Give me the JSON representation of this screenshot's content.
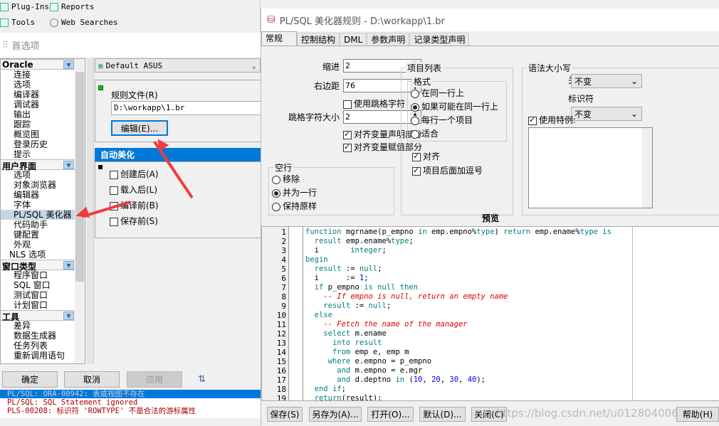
{
  "toolbar": {
    "items": [
      {
        "label": "Plug-Ins",
        "icon": "plugin-icon"
      },
      {
        "label": "Reports",
        "icon": "report-icon"
      },
      {
        "label": "Tools",
        "icon": "tools-icon"
      },
      {
        "label": "Web Searches",
        "icon": "globe-icon"
      }
    ]
  },
  "preferences": {
    "title": "首选项",
    "sidebar": {
      "groups": [
        {
          "label": "Oracle",
          "items": [
            "连接",
            "选项",
            "编译器",
            "调试器",
            "输出",
            "跟踪",
            "概览图",
            "登录历史",
            "提示"
          ]
        },
        {
          "label": "用户界面",
          "items": [
            "选项",
            "对象浏览器",
            "编辑器",
            "字体",
            "PL/SQL 美化器",
            "代码助手",
            "键配置",
            "外观",
            "NLS 选项"
          ]
        },
        {
          "label": "窗口类型",
          "items": [
            "程序窗口",
            "SQL 窗口",
            "测试窗口",
            "计划窗口"
          ]
        },
        {
          "label": "工具",
          "items": [
            "差异",
            "数据生成器",
            "任务列表",
            "重新调用语句"
          ]
        }
      ],
      "selected": "PL/SQL 美化器"
    },
    "profile": "Default ASUS",
    "rules_file_label": "规则文件(R)",
    "rules_file_value": "D:\\workapp\\1.br",
    "edit_button": "编辑(E)...",
    "auto_header": "自动美化",
    "auto_options": [
      {
        "label": "创建后(A)",
        "checked": false
      },
      {
        "label": "载入后(L)",
        "checked": false
      },
      {
        "label": "编译前(B)",
        "checked": false
      },
      {
        "label": "保存前(S)",
        "checked": false
      }
    ],
    "buttons": {
      "ok": "确定",
      "cancel": "取消",
      "apply": "应用"
    },
    "errors": [
      "PL/SQL: ORA-00942: 表或视图不存在",
      "PL/SQL: SQL Statement ignored",
      "PLS-00208: 标识符 'ROWTYPE' 不是合法的游标属性"
    ]
  },
  "dialog": {
    "title": "PL/SQL 美化器规则 - D:\\workapp\\1.br",
    "tabs": [
      "常规",
      "控制结构",
      "DML",
      "参数声明",
      "记录类型声明"
    ],
    "active_tab": "常规",
    "indent_label": "缩进",
    "indent_value": "2",
    "right_margin_label": "右边距",
    "right_margin_value": "76",
    "use_tab_label": "使用跳格字符",
    "use_tab": false,
    "tab_size_label": "跳格字符大小",
    "tab_size_value": "2",
    "align_decl_label": "对齐变量声明部分",
    "align_decl": true,
    "align_assign_label": "对齐变量赋值部分",
    "align_assign": true,
    "blank_lines": {
      "label": "空行",
      "options": [
        "移除",
        "并为一行",
        "保持原样"
      ],
      "selected": "并为一行"
    },
    "item_list": {
      "label": "项目列表",
      "format_label": "格式",
      "options": [
        "在同一行上",
        "如果可能在同一行上",
        "每行一个项目",
        "适合"
      ],
      "selected": "如果可能在同一行上",
      "align_label": "对齐",
      "align": true,
      "comma_label": "项目后面加逗号",
      "comma": true
    },
    "case": {
      "label": "语法大小写",
      "keyword_label": "关键字",
      "keyword_value": "不变",
      "identifier_label": "标识符",
      "identifier_value": "不变",
      "use_special_label": "使用特例:",
      "use_special": true
    },
    "preview_label": "预览",
    "code": [
      [
        [
          "k",
          "function "
        ],
        [
          "t",
          "mgrname(p_empno "
        ],
        [
          "k",
          "in "
        ],
        [
          "t",
          "emp.empno%"
        ],
        [
          "k",
          "type"
        ],
        [
          "t",
          ") "
        ],
        [
          "k",
          "return "
        ],
        [
          "t",
          "emp.ename%"
        ],
        [
          "k",
          "type is"
        ]
      ],
      [
        [
          "t",
          "  "
        ],
        [
          "k",
          "result "
        ],
        [
          "t",
          "emp.ename%"
        ],
        [
          "k",
          "type"
        ],
        [
          "t",
          ";"
        ]
      ],
      [
        [
          "t",
          "  i       "
        ],
        [
          "k",
          "integer"
        ],
        [
          "t",
          ";"
        ]
      ],
      [
        [
          "k",
          "begin"
        ]
      ],
      [
        [
          "t",
          "  "
        ],
        [
          "k",
          "result "
        ],
        [
          "t",
          ":= "
        ],
        [
          "k",
          "null"
        ],
        [
          "t",
          ";"
        ]
      ],
      [
        [
          "t",
          "  i      := "
        ],
        [
          "n",
          "1"
        ],
        [
          "t",
          ";"
        ]
      ],
      [
        [
          "t",
          "  "
        ],
        [
          "k",
          "if "
        ],
        [
          "t",
          "p_empno "
        ],
        [
          "k",
          "is null then"
        ]
      ],
      [
        [
          "t",
          "    "
        ],
        [
          "c",
          "-- If empno is null, return an empty name"
        ]
      ],
      [
        [
          "t",
          "    "
        ],
        [
          "k",
          "result "
        ],
        [
          "t",
          ":= "
        ],
        [
          "k",
          "null"
        ],
        [
          "t",
          ";"
        ]
      ],
      [
        [
          "t",
          "  "
        ],
        [
          "k",
          "else"
        ]
      ],
      [
        [
          "t",
          "    "
        ],
        [
          "c",
          "-- Fetch the name of the manager"
        ]
      ],
      [
        [
          "t",
          "    "
        ],
        [
          "k",
          "select "
        ],
        [
          "t",
          "m.ename"
        ]
      ],
      [
        [
          "t",
          "      "
        ],
        [
          "k",
          "into result"
        ]
      ],
      [
        [
          "t",
          "      "
        ],
        [
          "k",
          "from "
        ],
        [
          "t",
          "emp e, emp m"
        ]
      ],
      [
        [
          "t",
          "     "
        ],
        [
          "k",
          "where "
        ],
        [
          "t",
          "e.empno = p_empno"
        ]
      ],
      [
        [
          "t",
          "       "
        ],
        [
          "k",
          "and "
        ],
        [
          "t",
          "m.empno = e.mgr"
        ]
      ],
      [
        [
          "t",
          "       "
        ],
        [
          "k",
          "and "
        ],
        [
          "t",
          "d.deptno "
        ],
        [
          "k",
          "in "
        ],
        [
          "t",
          "("
        ],
        [
          "n",
          "10"
        ],
        [
          "t",
          ", "
        ],
        [
          "n",
          "20"
        ],
        [
          "t",
          ", "
        ],
        [
          "n",
          "30"
        ],
        [
          "t",
          ", "
        ],
        [
          "n",
          "40"
        ],
        [
          "t",
          ");"
        ]
      ],
      [
        [
          "t",
          "  "
        ],
        [
          "k",
          "end if"
        ],
        [
          "t",
          ";"
        ]
      ],
      [
        [
          "t",
          "  "
        ],
        [
          "k",
          "return"
        ],
        [
          "t",
          "(result);"
        ]
      ]
    ],
    "buttons": {
      "save": "保存(S)",
      "save_as": "另存为(A)...",
      "open": "打开(O)...",
      "default": "默认(D)...",
      "close": "关闭(C)",
      "help": "帮助(H)"
    },
    "watermark": "https://blog.csdn.net/u012804006"
  },
  "colors": {
    "selection": "#0078d7",
    "keyword": "#008080",
    "number": "#0000ff",
    "comment": "#e00000",
    "arrow": "#f03c3c"
  }
}
